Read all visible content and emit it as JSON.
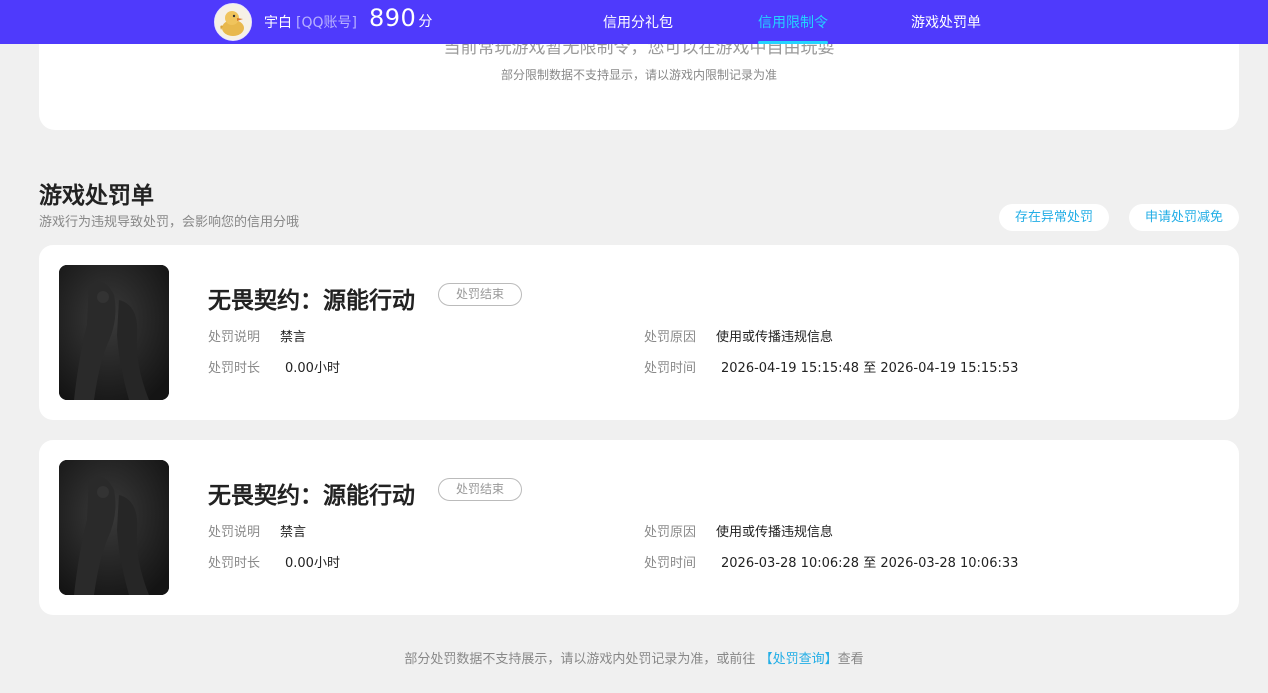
{
  "header": {
    "user_name": "宇白",
    "account_type": "[QQ账号]",
    "score": "890",
    "score_unit": "分",
    "nav": [
      {
        "label": "信用分礼包",
        "active": false
      },
      {
        "label": "信用限制令",
        "active": true
      },
      {
        "label": "游戏处罚单",
        "active": false
      }
    ]
  },
  "restriction": {
    "main_text_cut": "当前常玩游戏暂无限制令，您可以在游戏中自由玩耍",
    "note": "部分限制数据不支持显示，请以游戏内限制记录为准"
  },
  "penalty_section": {
    "title": "游戏处罚单",
    "subtitle": "游戏行为违规导致处罚，会影响您的信用分哦",
    "btn_abnormal": "存在异常处罚",
    "btn_apply": "申请处罚减免"
  },
  "penalties": [
    {
      "game": "无畏契约：源能行动",
      "status": "处罚结束",
      "desc_label": "处罚说明",
      "desc": "禁言",
      "reason_label": "处罚原因",
      "reason": "使用或传播违规信息",
      "duration_label": "处罚时长",
      "duration": "0.00小时",
      "time_label": "处罚时间",
      "time": "2026-04-19 15:15:48 至 2026-04-19 15:15:53"
    },
    {
      "game": "无畏契约：源能行动",
      "status": "处罚结束",
      "desc_label": "处罚说明",
      "desc": "禁言",
      "reason_label": "处罚原因",
      "reason": "使用或传播违规信息",
      "duration_label": "处罚时长",
      "duration": "0.00小时",
      "time_label": "处罚时间",
      "time": "2026-03-28 10:06:28 至 2026-03-28 10:06:33"
    }
  ],
  "footer": {
    "note_prefix": "部分处罚数据不支持展示，请以游戏内处罚记录为准，或前往",
    "link": "【处罚查询】",
    "note_suffix": "查看"
  },
  "colors": {
    "header_bg": "#4f3afc",
    "accent": "#23d3ff",
    "link": "#23aee6",
    "page_bg": "#f0f0f0"
  }
}
